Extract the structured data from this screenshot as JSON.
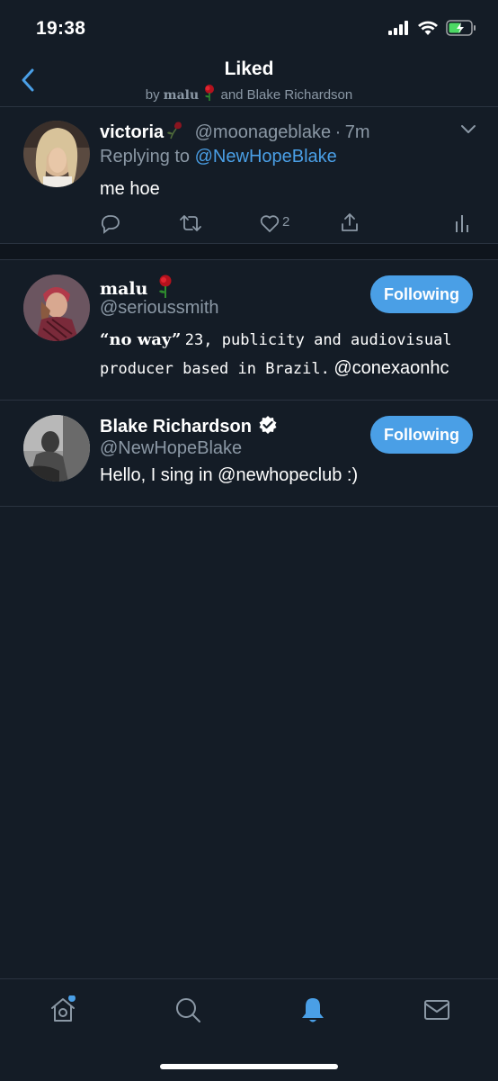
{
  "status_bar": {
    "time": "19:38"
  },
  "header": {
    "title": "Liked",
    "subtitle_prefix": "by",
    "subtitle_user": "malu",
    "subtitle_suffix": "and Blake Richardson"
  },
  "tweet": {
    "name": "victoria",
    "handle": "@moonageblake",
    "dot": "·",
    "time": "7m",
    "reply_prefix": "Replying to",
    "reply_to": "@NewHopeBlake",
    "text": "me hoe",
    "like_count": "2"
  },
  "users": [
    {
      "name": "malu",
      "handle": "@serioussmith",
      "bio_quote": "“no way”",
      "bio_mono": "23, publicity and audiovisual producer based in Brazil.",
      "bio_link": "@conexaonhc",
      "follow_label": "Following"
    },
    {
      "name": "Blake Richardson",
      "handle": "@NewHopeBlake",
      "bio": "Hello, I sing in @newhopeclub :)",
      "follow_label": "Following"
    }
  ],
  "colors": {
    "background": "#141c26",
    "accent": "#4a9fe6",
    "secondary_text": "#8b98a5"
  },
  "icons": {
    "back": "chevron-left-icon",
    "tabs": [
      "home-icon",
      "search-icon",
      "bell-icon",
      "mail-icon"
    ]
  }
}
